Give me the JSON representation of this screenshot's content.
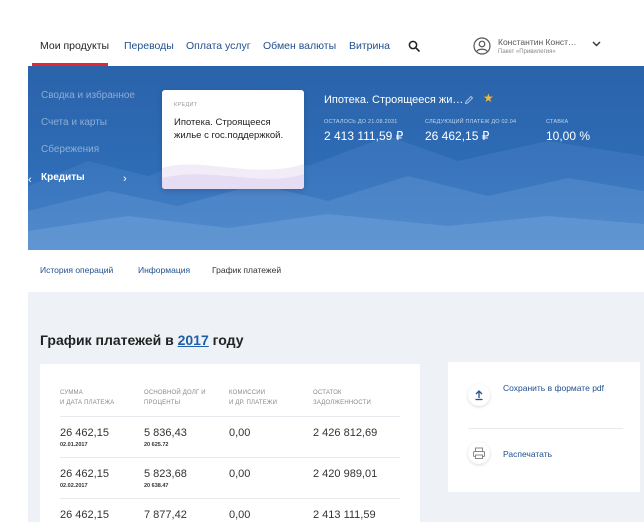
{
  "topnav": {
    "items": [
      "Мои продукты",
      "Переводы",
      "Оплата услуг",
      "Обмен валюты",
      "Витрина"
    ],
    "user_name": "Константин Конст…",
    "user_package": "Пакет «Привилегия»"
  },
  "sidebar": {
    "items": [
      "Сводка и избранное",
      "Счета и карты",
      "Сбережения",
      "Кредиты"
    ]
  },
  "card": {
    "label": "КРЕДИТ",
    "title": "Ипотека. Строящееся жилье с гос.поддержкой."
  },
  "loan": {
    "title": "Ипотека. Строящееся жи…",
    "stats": [
      {
        "label": "ОСТАЛОСЬ ДО 21.08.2031",
        "value": "2 413 111,59 ₽"
      },
      {
        "label": "СЛЕДУЮЩИЙ ПЛАТЕЖ ДО 02.04",
        "value": "26 462,15 ₽"
      },
      {
        "label": "СТАВКА",
        "value": "10,00 %"
      }
    ]
  },
  "tabs": [
    "История операций",
    "Информация",
    "График платежей"
  ],
  "schedule": {
    "heading_prefix": "График платежей в",
    "year": "2017",
    "heading_suffix": "году",
    "columns": [
      [
        "СУММА",
        "И ДАТА ПЛАТЕЖА"
      ],
      [
        "ОСНОВНОЙ ДОЛГ И",
        "ПРОЦЕНТЫ"
      ],
      [
        "КОМИССИИ",
        "И ДР. ПЛАТЕЖИ"
      ],
      [
        "ОСТАТОК",
        "ЗАДОЛЖЕННОСТИ"
      ]
    ],
    "rows": [
      {
        "amount": "26 462,15",
        "date": "02.01.2017",
        "principal": "5 836,43",
        "interest": "20 625.72",
        "fees": "0,00",
        "balance": "2 426 812,69"
      },
      {
        "amount": "26 462,15",
        "date": "02.02.2017",
        "principal": "5 823,68",
        "interest": "20 638.47",
        "fees": "0,00",
        "balance": "2 420 989,01"
      },
      {
        "amount": "26 462,15",
        "date": "",
        "principal": "7 877,42",
        "interest": "",
        "fees": "0,00",
        "balance": "2 413 111,59"
      }
    ]
  },
  "actions": {
    "save_pdf": "Сохранить в формате pdf",
    "print": "Распечатать"
  },
  "colors": {
    "accent_red": "#e3262f",
    "link_blue": "#1f4f8f",
    "hero_blue": "#2e6cb6",
    "star": "#f5b82e"
  }
}
